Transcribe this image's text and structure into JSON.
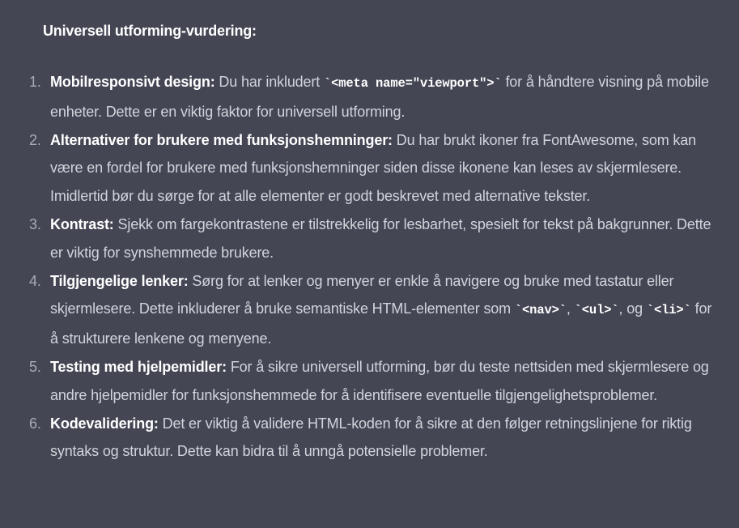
{
  "title": "Universell utforming-vurdering:",
  "items": [
    {
      "num": "1.",
      "lead": "Mobilresponsivt design:",
      "t1": " Du har inkludert ",
      "c1": "`<meta name=\"viewport\">`",
      "t2": " for å håndtere visning på mobile enheter. Dette er en viktig faktor for universell utforming."
    },
    {
      "num": "2.",
      "lead": "Alternativer for brukere med funksjonshemninger:",
      "t1": " Du har brukt ikoner fra FontAwesome, som kan være en fordel for brukere med funksjonshemninger siden disse ikonene kan leses av skjermlesere. Imidlertid bør du sørge for at alle elementer er godt beskrevet med alternative tekster."
    },
    {
      "num": "3.",
      "lead": "Kontrast:",
      "t1": " Sjekk om fargekontrastene er tilstrekkelig for lesbarhet, spesielt for tekst på bakgrunner. Dette er viktig for synshemmede brukere."
    },
    {
      "num": "4.",
      "lead": "Tilgjengelige lenker:",
      "t1": " Sørg for at lenker og menyer er enkle å navigere og bruke med tastatur eller skjermlesere. Dette inkluderer å bruke semantiske HTML-elementer som ",
      "c1": "`<nav>`",
      "t2": ", ",
      "c2": "`<ul>`",
      "t3": ", og ",
      "c3": "`<li>`",
      "t4": " for å strukturere lenkene og menyene."
    },
    {
      "num": "5.",
      "lead": "Testing med hjelpemidler:",
      "t1": " For å sikre universell utforming, bør du teste nettsiden med skjermlesere og andre hjelpemidler for funksjonshemmede for å identifisere eventuelle tilgjengelighetsproblemer."
    },
    {
      "num": "6.",
      "lead": "Kodevalidering:",
      "t1": " Det er viktig å validere HTML-koden for å sikre at den følger retningslinjene for riktig syntaks og struktur. Dette kan bidra til å unngå potensielle problemer."
    }
  ]
}
